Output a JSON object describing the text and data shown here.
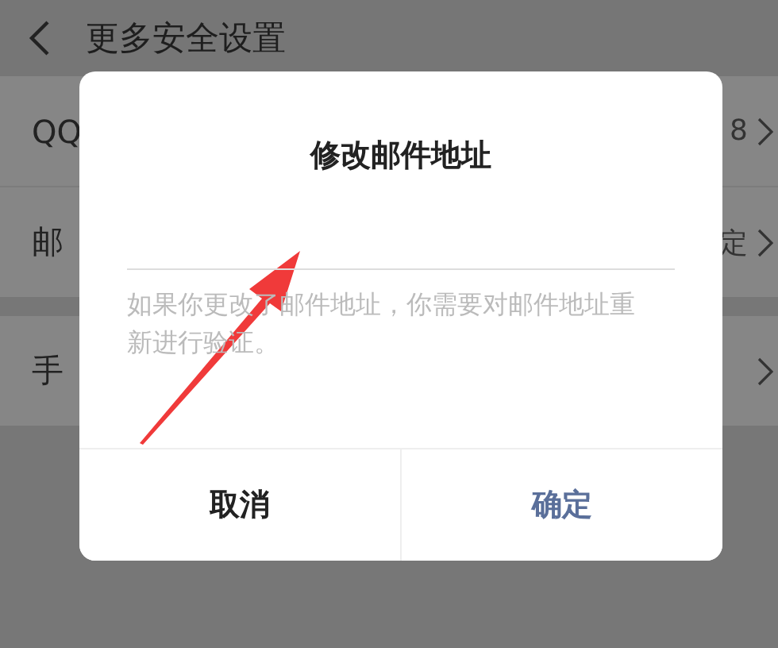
{
  "header": {
    "title": "更多安全设置"
  },
  "groups": [
    [
      {
        "label": "QQ",
        "value": "8"
      },
      {
        "label": "邮",
        "value": "定"
      }
    ],
    [
      {
        "label": "手"
      }
    ]
  ],
  "dialog": {
    "title": "修改邮件地址",
    "hint": "如果你更改了邮件地址，你需要对邮件地址重新进行验证。",
    "buttons": [
      {
        "label": "取消",
        "kind": "cancel"
      },
      {
        "label": "确定",
        "kind": "confirm"
      }
    ]
  }
}
